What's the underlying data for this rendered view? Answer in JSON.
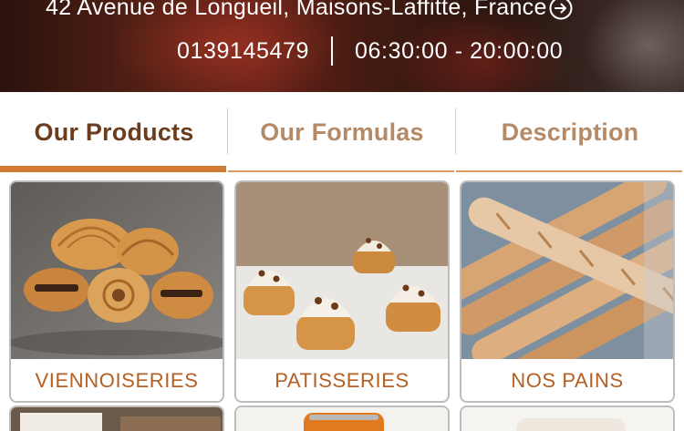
{
  "store": {
    "address": "42 Avenue de Longueil, Maisons-Laffitte, France",
    "phone": "0139145479",
    "hours": "06:30:00 - 20:00:00"
  },
  "tabs": [
    {
      "label": "Our Products",
      "active": true
    },
    {
      "label": "Our Formulas",
      "active": false
    },
    {
      "label": "Description",
      "active": false
    }
  ],
  "products": [
    {
      "name": "VIENNOISERIES",
      "image_icon": "croissant-photo"
    },
    {
      "name": "PATISSERIES",
      "image_icon": "pastry-photo"
    },
    {
      "name": "NOS PAINS",
      "image_icon": "baguette-photo"
    }
  ],
  "colors": {
    "accent": "#d27b35",
    "active_tab_text": "#6b3d1e",
    "inactive_tab_text": "#b58a66",
    "caption_text": "#b45f23"
  }
}
